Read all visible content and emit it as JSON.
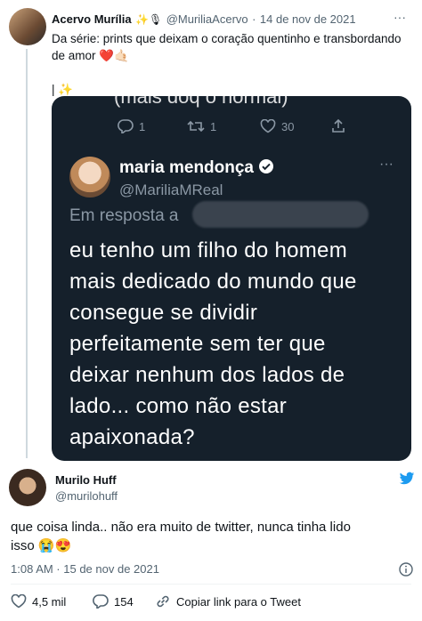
{
  "tweet1": {
    "author_name": "Acervo Murília",
    "author_emojis": "✨🎙",
    "handle": "@MuriliaAcervo",
    "separator": "·",
    "date": "14 de nov de 2021",
    "text_line1": "Da série: prints que deixam o coração quentinho e transbordando",
    "text_line2": "de amor ❤️🤙🏻",
    "text_line3": "| ✨",
    "more": "···"
  },
  "embedded": {
    "cut_top_text": "(mais doq o normal)",
    "actions": {
      "replies": "1",
      "retweets": "1",
      "likes": "30"
    },
    "author_name": "maria mendonça",
    "handle": "@MariliaMReal",
    "reply_prefix": "Em resposta a",
    "text_lines": [
      "eu tenho um filho do homem",
      "mais dedicado do mundo que",
      "consegue se dividir",
      "perfeitamente sem ter que",
      "deixar nenhum dos lados de",
      "lado... como não estar",
      "apaixonada?"
    ],
    "more": "···"
  },
  "tweet2": {
    "author_name": "Murilo Huff",
    "handle": "@murilohuff",
    "text_line1": "que coisa linda.. não era muito de twitter, nunca tinha lido",
    "text_line2": "isso 😭😍",
    "timestamp": "1:08 AM · 15 de nov de 2021",
    "likes": "4,5 mil",
    "replies": "154",
    "copy_link": "Copiar link para o Tweet"
  },
  "colors": {
    "accent": "#1d9bf0",
    "like_red": "#f91880",
    "dark_bg": "#15202b",
    "muted": "#536471"
  }
}
